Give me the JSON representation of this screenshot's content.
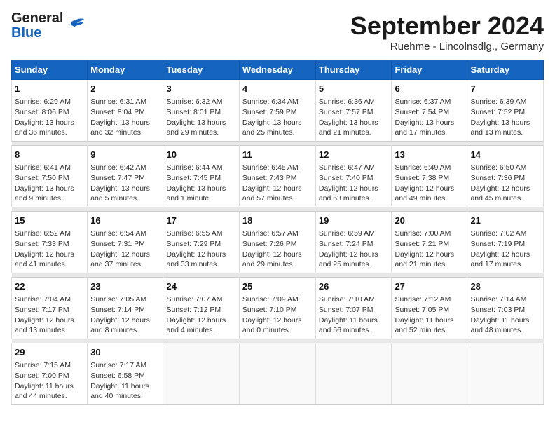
{
  "header": {
    "logo_line1": "General",
    "logo_line2": "Blue",
    "title": "September 2024",
    "subtitle": "Ruehme - Lincolnsdlg., Germany"
  },
  "weekdays": [
    "Sunday",
    "Monday",
    "Tuesday",
    "Wednesday",
    "Thursday",
    "Friday",
    "Saturday"
  ],
  "weeks": [
    [
      {
        "day": 1,
        "lines": [
          "Sunrise: 6:29 AM",
          "Sunset: 8:06 PM",
          "Daylight: 13 hours",
          "and 36 minutes."
        ]
      },
      {
        "day": 2,
        "lines": [
          "Sunrise: 6:31 AM",
          "Sunset: 8:04 PM",
          "Daylight: 13 hours",
          "and 32 minutes."
        ]
      },
      {
        "day": 3,
        "lines": [
          "Sunrise: 6:32 AM",
          "Sunset: 8:01 PM",
          "Daylight: 13 hours",
          "and 29 minutes."
        ]
      },
      {
        "day": 4,
        "lines": [
          "Sunrise: 6:34 AM",
          "Sunset: 7:59 PM",
          "Daylight: 13 hours",
          "and 25 minutes."
        ]
      },
      {
        "day": 5,
        "lines": [
          "Sunrise: 6:36 AM",
          "Sunset: 7:57 PM",
          "Daylight: 13 hours",
          "and 21 minutes."
        ]
      },
      {
        "day": 6,
        "lines": [
          "Sunrise: 6:37 AM",
          "Sunset: 7:54 PM",
          "Daylight: 13 hours",
          "and 17 minutes."
        ]
      },
      {
        "day": 7,
        "lines": [
          "Sunrise: 6:39 AM",
          "Sunset: 7:52 PM",
          "Daylight: 13 hours",
          "and 13 minutes."
        ]
      }
    ],
    [
      {
        "day": 8,
        "lines": [
          "Sunrise: 6:41 AM",
          "Sunset: 7:50 PM",
          "Daylight: 13 hours",
          "and 9 minutes."
        ]
      },
      {
        "day": 9,
        "lines": [
          "Sunrise: 6:42 AM",
          "Sunset: 7:47 PM",
          "Daylight: 13 hours",
          "and 5 minutes."
        ]
      },
      {
        "day": 10,
        "lines": [
          "Sunrise: 6:44 AM",
          "Sunset: 7:45 PM",
          "Daylight: 13 hours",
          "and 1 minute."
        ]
      },
      {
        "day": 11,
        "lines": [
          "Sunrise: 6:45 AM",
          "Sunset: 7:43 PM",
          "Daylight: 12 hours",
          "and 57 minutes."
        ]
      },
      {
        "day": 12,
        "lines": [
          "Sunrise: 6:47 AM",
          "Sunset: 7:40 PM",
          "Daylight: 12 hours",
          "and 53 minutes."
        ]
      },
      {
        "day": 13,
        "lines": [
          "Sunrise: 6:49 AM",
          "Sunset: 7:38 PM",
          "Daylight: 12 hours",
          "and 49 minutes."
        ]
      },
      {
        "day": 14,
        "lines": [
          "Sunrise: 6:50 AM",
          "Sunset: 7:36 PM",
          "Daylight: 12 hours",
          "and 45 minutes."
        ]
      }
    ],
    [
      {
        "day": 15,
        "lines": [
          "Sunrise: 6:52 AM",
          "Sunset: 7:33 PM",
          "Daylight: 12 hours",
          "and 41 minutes."
        ]
      },
      {
        "day": 16,
        "lines": [
          "Sunrise: 6:54 AM",
          "Sunset: 7:31 PM",
          "Daylight: 12 hours",
          "and 37 minutes."
        ]
      },
      {
        "day": 17,
        "lines": [
          "Sunrise: 6:55 AM",
          "Sunset: 7:29 PM",
          "Daylight: 12 hours",
          "and 33 minutes."
        ]
      },
      {
        "day": 18,
        "lines": [
          "Sunrise: 6:57 AM",
          "Sunset: 7:26 PM",
          "Daylight: 12 hours",
          "and 29 minutes."
        ]
      },
      {
        "day": 19,
        "lines": [
          "Sunrise: 6:59 AM",
          "Sunset: 7:24 PM",
          "Daylight: 12 hours",
          "and 25 minutes."
        ]
      },
      {
        "day": 20,
        "lines": [
          "Sunrise: 7:00 AM",
          "Sunset: 7:21 PM",
          "Daylight: 12 hours",
          "and 21 minutes."
        ]
      },
      {
        "day": 21,
        "lines": [
          "Sunrise: 7:02 AM",
          "Sunset: 7:19 PM",
          "Daylight: 12 hours",
          "and 17 minutes."
        ]
      }
    ],
    [
      {
        "day": 22,
        "lines": [
          "Sunrise: 7:04 AM",
          "Sunset: 7:17 PM",
          "Daylight: 12 hours",
          "and 13 minutes."
        ]
      },
      {
        "day": 23,
        "lines": [
          "Sunrise: 7:05 AM",
          "Sunset: 7:14 PM",
          "Daylight: 12 hours",
          "and 8 minutes."
        ]
      },
      {
        "day": 24,
        "lines": [
          "Sunrise: 7:07 AM",
          "Sunset: 7:12 PM",
          "Daylight: 12 hours",
          "and 4 minutes."
        ]
      },
      {
        "day": 25,
        "lines": [
          "Sunrise: 7:09 AM",
          "Sunset: 7:10 PM",
          "Daylight: 12 hours",
          "and 0 minutes."
        ]
      },
      {
        "day": 26,
        "lines": [
          "Sunrise: 7:10 AM",
          "Sunset: 7:07 PM",
          "Daylight: 11 hours",
          "and 56 minutes."
        ]
      },
      {
        "day": 27,
        "lines": [
          "Sunrise: 7:12 AM",
          "Sunset: 7:05 PM",
          "Daylight: 11 hours",
          "and 52 minutes."
        ]
      },
      {
        "day": 28,
        "lines": [
          "Sunrise: 7:14 AM",
          "Sunset: 7:03 PM",
          "Daylight: 11 hours",
          "and 48 minutes."
        ]
      }
    ],
    [
      {
        "day": 29,
        "lines": [
          "Sunrise: 7:15 AM",
          "Sunset: 7:00 PM",
          "Daylight: 11 hours",
          "and 44 minutes."
        ]
      },
      {
        "day": 30,
        "lines": [
          "Sunrise: 7:17 AM",
          "Sunset: 6:58 PM",
          "Daylight: 11 hours",
          "and 40 minutes."
        ]
      },
      null,
      null,
      null,
      null,
      null
    ]
  ]
}
